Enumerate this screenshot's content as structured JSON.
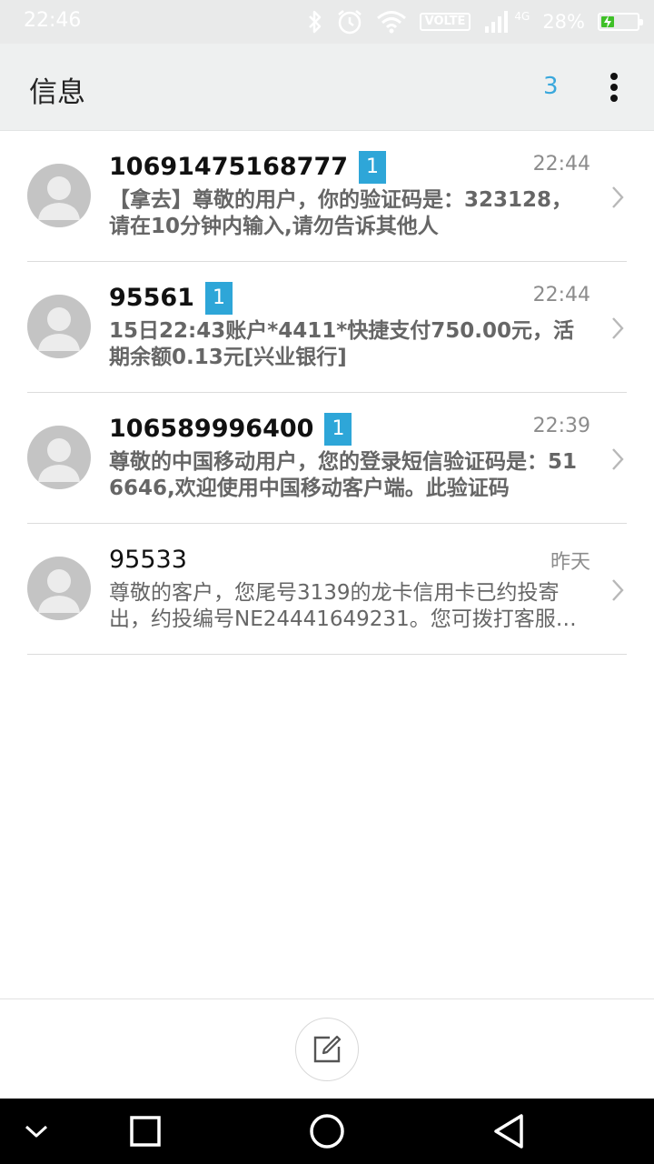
{
  "status_bar": {
    "time": "22:46",
    "volte": "VOLTE",
    "network": "4G",
    "battery_percent": "28%",
    "battery_level": 0.28,
    "icons": [
      "bluetooth-icon",
      "alarm-icon",
      "wifi-icon",
      "volte-icon",
      "signal-icon",
      "battery-icon"
    ]
  },
  "app_bar": {
    "title": "信息",
    "unread_count": "3",
    "more_icon": "more-vertical-icon"
  },
  "messages": [
    {
      "sender": "10691475168777",
      "badge": "1",
      "time": "22:44",
      "snippet": "【拿去】尊敬的用户，你的验证码是：323128，请在10分钟内输入,请勿告诉其他人",
      "unread": true
    },
    {
      "sender": "95561",
      "badge": "1",
      "time": "22:44",
      "snippet": "15日22:43账户*4411*快捷支付750.00元，活期余额0.13元[兴业银行]",
      "unread": true
    },
    {
      "sender": "106589996400",
      "badge": "1",
      "time": "22:39",
      "snippet": "尊敬的中国移动用户，您的登录短信验证码是：516646,欢迎使用中国移动客户端。此验证码",
      "unread": true
    },
    {
      "sender": "95533",
      "badge": "",
      "time": "昨天",
      "snippet": "尊敬的客户，您尾号3139的龙卡信用卡已约投寄出，约投编号NE24441649231。您可拨打客服热线",
      "unread": false
    }
  ],
  "compose": {
    "icon": "compose-icon"
  },
  "nav_bar": {
    "icons": [
      "collapse-icon",
      "recents-icon",
      "home-icon",
      "back-icon"
    ]
  },
  "colors": {
    "accent": "#2ea6d8",
    "app_bar_bg": "#eef0f0",
    "avatar_bg": "#c4c4c4",
    "battery_fill": "#3fc028"
  }
}
